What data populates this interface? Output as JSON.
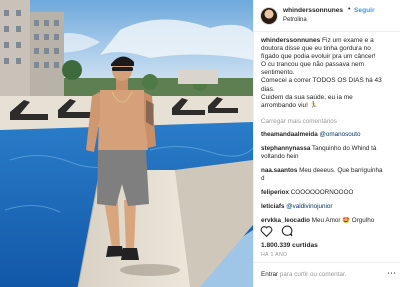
{
  "post": {
    "username": "whinderssonnunes",
    "follow_label": "Seguir",
    "separator": "•",
    "location": "Petrolina",
    "caption_lines": [
      "Fiz um exame e a",
      "doutora disse que eu tinha gordura no",
      "fígado que podia evoluir pra um câncer!",
      "O cu trancou que não passava nem",
      "sentimento.",
      "Comecei a correr TODOS OS DIAS há 43",
      "dias.",
      "Cuidem da sua saúde, eu ia me",
      "arrombando viu! 🏃‍♂️"
    ],
    "load_more": "Carregar mais comentários",
    "comments": [
      {
        "user": "theamandaalmeida",
        "mention": "@omanosouto",
        "text": ""
      },
      {
        "user": "stephannynassa",
        "mention": "",
        "text": "Tanquinho do Whind tá"
      },
      {
        "user": "",
        "mention": "",
        "text": "voltando hein"
      },
      {
        "user": "naa.saantos",
        "mention": "",
        "text": "Meu deeeus. Que barriguinha"
      },
      {
        "user": "",
        "mention": "",
        "text": "d"
      },
      {
        "user": "feliperiox",
        "mention": "",
        "text": "COOOOOORNOOOO"
      },
      {
        "user": "leticiafs",
        "mention": "@valdivinojunior",
        "text": ""
      },
      {
        "user": "ervkka_leocadio",
        "mention": "",
        "text": "Meu Amor 🤩 Orgulho"
      }
    ],
    "likes": "1.800.339 curtidas",
    "time_ago": "HÁ 1 ANO",
    "login_link": "Entrar",
    "login_rest": "para curtir ou comentar.",
    "more_glyph": "⋯",
    "icons": [
      "heart-icon",
      "comment-icon",
      "more-options-icon"
    ]
  }
}
